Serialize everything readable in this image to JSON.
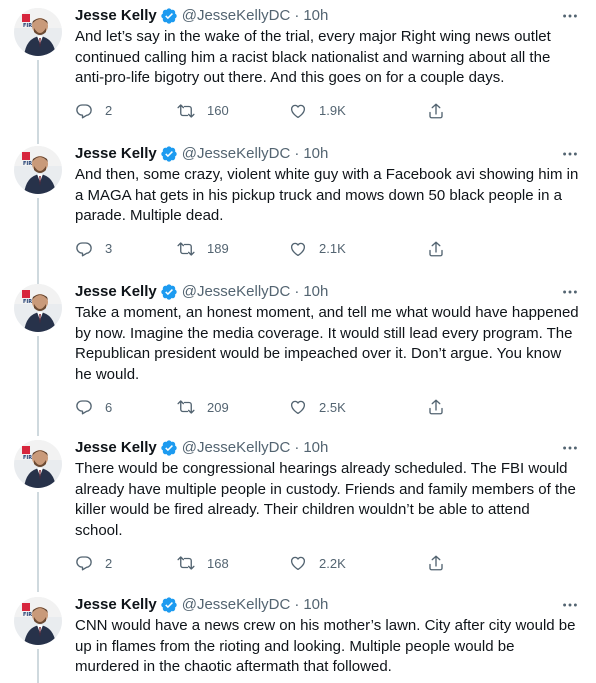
{
  "colors": {
    "verified": "#1d9bf0",
    "secondary_text": "#536471",
    "thread_line": "#cfd9de",
    "text": "#0f1419"
  },
  "tweets": [
    {
      "name": "Jesse Kelly",
      "handle": "@JesseKellyDC",
      "separator": "·",
      "time": "10h",
      "text": "And let’s say in the wake of the trial, every major Right wing news outlet continued calling him a racist black nationalist and warning about all the anti-pro-life bigotry out there. And this goes on for a couple days.",
      "replies": "2",
      "retweets": "160",
      "likes": "1.9K"
    },
    {
      "name": "Jesse Kelly",
      "handle": "@JesseKellyDC",
      "separator": "·",
      "time": "10h",
      "text": "And then, some crazy, violent white guy with a Facebook avi showing him in a MAGA hat gets in his pickup truck and mows down 50 black people in a parade. Multiple dead.",
      "replies": "3",
      "retweets": "189",
      "likes": "2.1K"
    },
    {
      "name": "Jesse Kelly",
      "handle": "@JesseKellyDC",
      "separator": "·",
      "time": "10h",
      "text": "Take a moment, an honest moment, and tell me what would have happened by now. Imagine the media coverage. It would still lead every program. The Republican president would be impeached over it. Don’t argue. You know he would.",
      "replies": "6",
      "retweets": "209",
      "likes": "2.5K"
    },
    {
      "name": "Jesse Kelly",
      "handle": "@JesseKellyDC",
      "separator": "·",
      "time": "10h",
      "text": "There would be congressional hearings already scheduled. The FBI would already have multiple people in custody. Friends and family members of the killer would be fired already. Their children wouldn’t be able to attend school.",
      "replies": "2",
      "retweets": "168",
      "likes": "2.2K"
    },
    {
      "name": "Jesse Kelly",
      "handle": "@JesseKellyDC",
      "separator": "·",
      "time": "10h",
      "text": "CNN would have a news crew on his mother’s lawn. City after city would be up in flames from the rioting and looking. Multiple people would be murdered in the chaotic aftermath that followed.",
      "replies": "",
      "retweets": "",
      "likes": ""
    }
  ]
}
